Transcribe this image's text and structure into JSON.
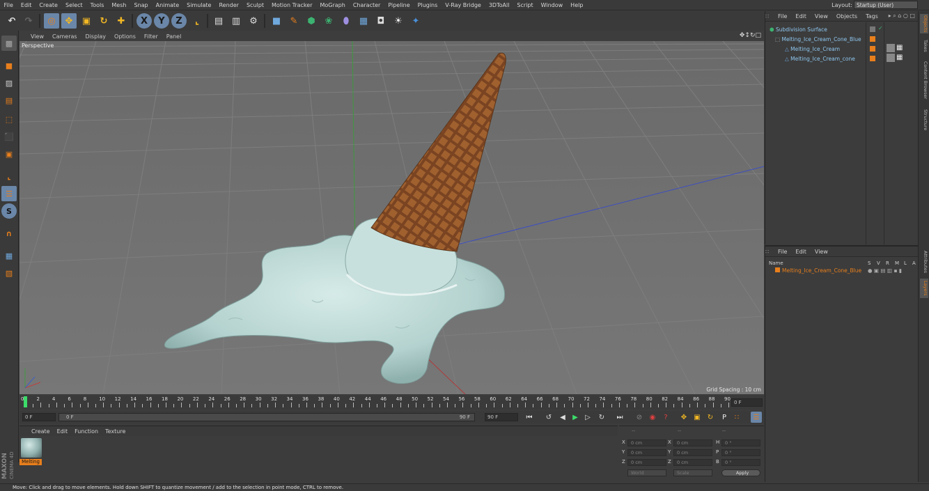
{
  "menubar": {
    "items": [
      "File",
      "Edit",
      "Create",
      "Select",
      "Tools",
      "Mesh",
      "Snap",
      "Animate",
      "Simulate",
      "Render",
      "Sculpt",
      "Motion Tracker",
      "MoGraph",
      "Character",
      "Pipeline",
      "Plugins",
      "V-Ray Bridge",
      "3DToAll",
      "Script",
      "Window",
      "Help"
    ],
    "layout_label": "Layout:",
    "layout_value": "Startup (User)"
  },
  "toolbar": {
    "axis_x": "X",
    "axis_y": "Y",
    "axis_z": "Z"
  },
  "viewport": {
    "menu": [
      "View",
      "Cameras",
      "Display",
      "Options",
      "Filter",
      "Panel"
    ],
    "label": "Perspective",
    "grid_spacing": "Grid Spacing : 10 cm"
  },
  "timeline": {
    "ticks": [
      "0",
      "2",
      "4",
      "6",
      "8",
      "10",
      "12",
      "14",
      "16",
      "18",
      "20",
      "22",
      "24",
      "26",
      "28",
      "30",
      "32",
      "34",
      "36",
      "38",
      "40",
      "42",
      "44",
      "46",
      "48",
      "50",
      "52",
      "54",
      "56",
      "58",
      "60",
      "62",
      "64",
      "66",
      "68",
      "70",
      "72",
      "74",
      "76",
      "78",
      "80",
      "82",
      "84",
      "86",
      "88",
      "90"
    ],
    "current_frame": "0 F"
  },
  "controls": {
    "start_frame": "0 F",
    "slider_start": "0 F",
    "slider_end": "90 F",
    "end_frame": "90 F"
  },
  "material_panel": {
    "menu": [
      "Create",
      "Edit",
      "Function",
      "Texture"
    ],
    "material_name": "Melting"
  },
  "coord_panel": {
    "header_dashes": [
      "--",
      "--",
      "--"
    ],
    "rows": [
      {
        "a": "X",
        "av": "0 cm",
        "b": "X",
        "bv": "0 cm",
        "c": "H",
        "cv": "0 °"
      },
      {
        "a": "Y",
        "av": "0 cm",
        "b": "Y",
        "bv": "0 cm",
        "c": "P",
        "cv": "0 °"
      },
      {
        "a": "Z",
        "av": "0 cm",
        "b": "Z",
        "bv": "0 cm",
        "c": "B",
        "cv": "0 °"
      }
    ],
    "space": "World",
    "mode": "Scale",
    "apply": "Apply"
  },
  "object_panel": {
    "menu": [
      "File",
      "Edit",
      "View",
      "Objects",
      "Tags"
    ],
    "objects": [
      {
        "name": "Subdivision Surface",
        "indent": 0
      },
      {
        "name": "Melting_Ice_Cream_Cone_Blue",
        "indent": 1
      },
      {
        "name": "Melting_Ice_Cream",
        "indent": 2
      },
      {
        "name": "Melting_Ice_Cream_cone",
        "indent": 2
      }
    ]
  },
  "layer_panel": {
    "menu": [
      "File",
      "Edit",
      "View"
    ],
    "header_name": "Name",
    "header_cols": [
      "S",
      "V",
      "R",
      "M",
      "L",
      "A"
    ],
    "layer_name": "Melting_Ice_Cream_Cone_Blue"
  },
  "side_tabs": [
    "Objects",
    "Takes",
    "Content Browser",
    "Structure",
    "Attributes",
    "Layers"
  ],
  "brand": {
    "line1": "MAXON",
    "line2": "CINEMA 4D"
  },
  "status": "Move: Click and drag to move elements. Hold down SHIFT to quantize movement / add to the selection in point mode, CTRL to remove.",
  "colors": {
    "accent": "#e87f1c",
    "viewport_bg": "#6e6e6e",
    "object_text": "#8fc7ef",
    "tool_blue": "#6fa8dc"
  }
}
